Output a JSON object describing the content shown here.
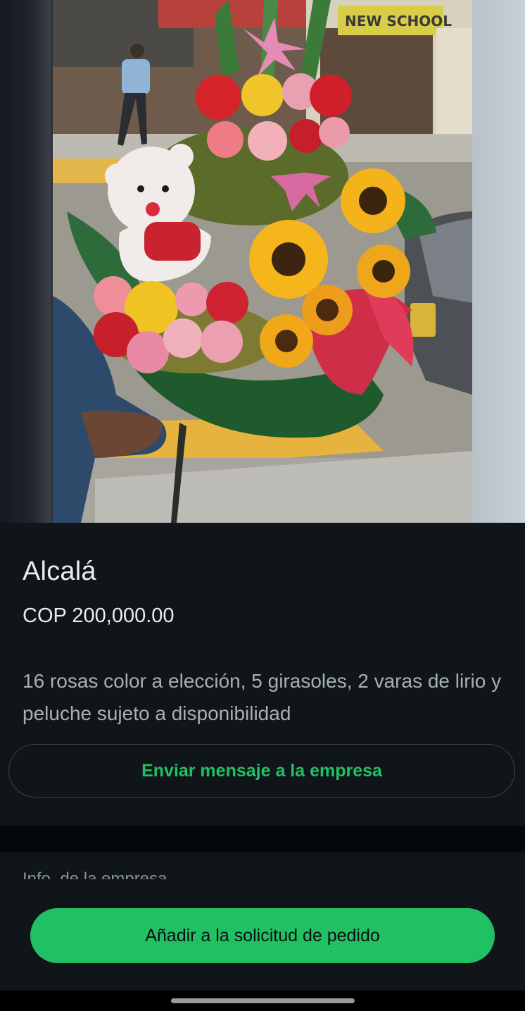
{
  "product": {
    "title": "Alcalá",
    "price": "COP 200,000.00",
    "description": "16 rosas color a elección, 5 girasoles, 2 varas de lirio y peluche sujeto a disponibilidad",
    "image_sign_text": "NEW SCHOOL"
  },
  "actions": {
    "message_label": "Enviar mensaje a la empresa",
    "add_label": "Añadir a la solicitud de pedido"
  },
  "company": {
    "heading": "Info. de la empresa"
  },
  "colors": {
    "accent": "#21c063",
    "background": "#0b1014",
    "surface": "#0f1519"
  }
}
